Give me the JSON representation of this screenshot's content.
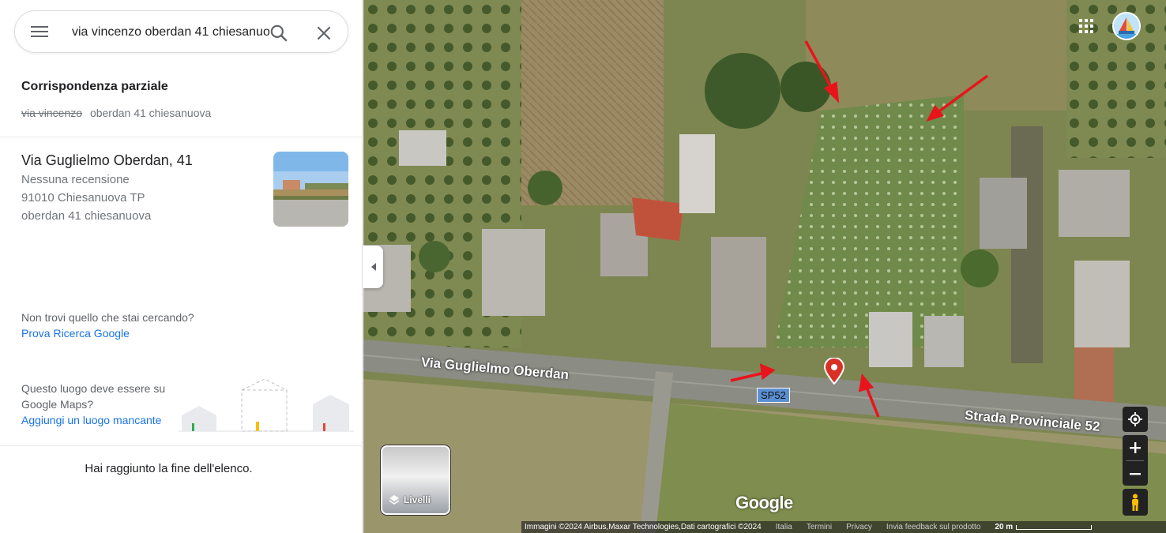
{
  "search": {
    "value": "via vincenzo oberdan 41 chiesanuova",
    "menu_icon": "menu-icon",
    "search_icon": "search-icon",
    "clear_icon": "close-icon"
  },
  "partial_match": {
    "title": "Corrispondenza parziale",
    "struck": "via vincenzo",
    "rest": "oberdan 41 chiesanuova"
  },
  "result": {
    "name": "Via Guglielmo Oberdan, 41",
    "reviews": "Nessuna recensione",
    "address": "91010 Chiesanuova TP",
    "query": "oberdan 41 chiesanuova"
  },
  "help": {
    "not_found": "Non trovi quello che stai cercando?",
    "google_search": "Prova Ricerca Google",
    "missing_q": "Questo luogo deve essere su Google Maps?",
    "add_missing": "Aggiungi un luogo mancante",
    "end_of_list": "Hai raggiunto la fine dell'elenco."
  },
  "map": {
    "road_main": "Via Guglielmo Oberdan",
    "road_prov": "Strada Provinciale 52",
    "shield": "SP52",
    "layers_label": "Livelli",
    "google_logo": "Google",
    "footer": {
      "attribution": "Immagini ©2024 Airbus,Maxar Technologies,Dati cartografici ©2024",
      "links": [
        "Italia",
        "Termini",
        "Privacy",
        "Invia feedback sul prodotto"
      ],
      "scale": "20 m"
    },
    "pin_color": "#d93025",
    "arrow_color": "#e8141b"
  }
}
